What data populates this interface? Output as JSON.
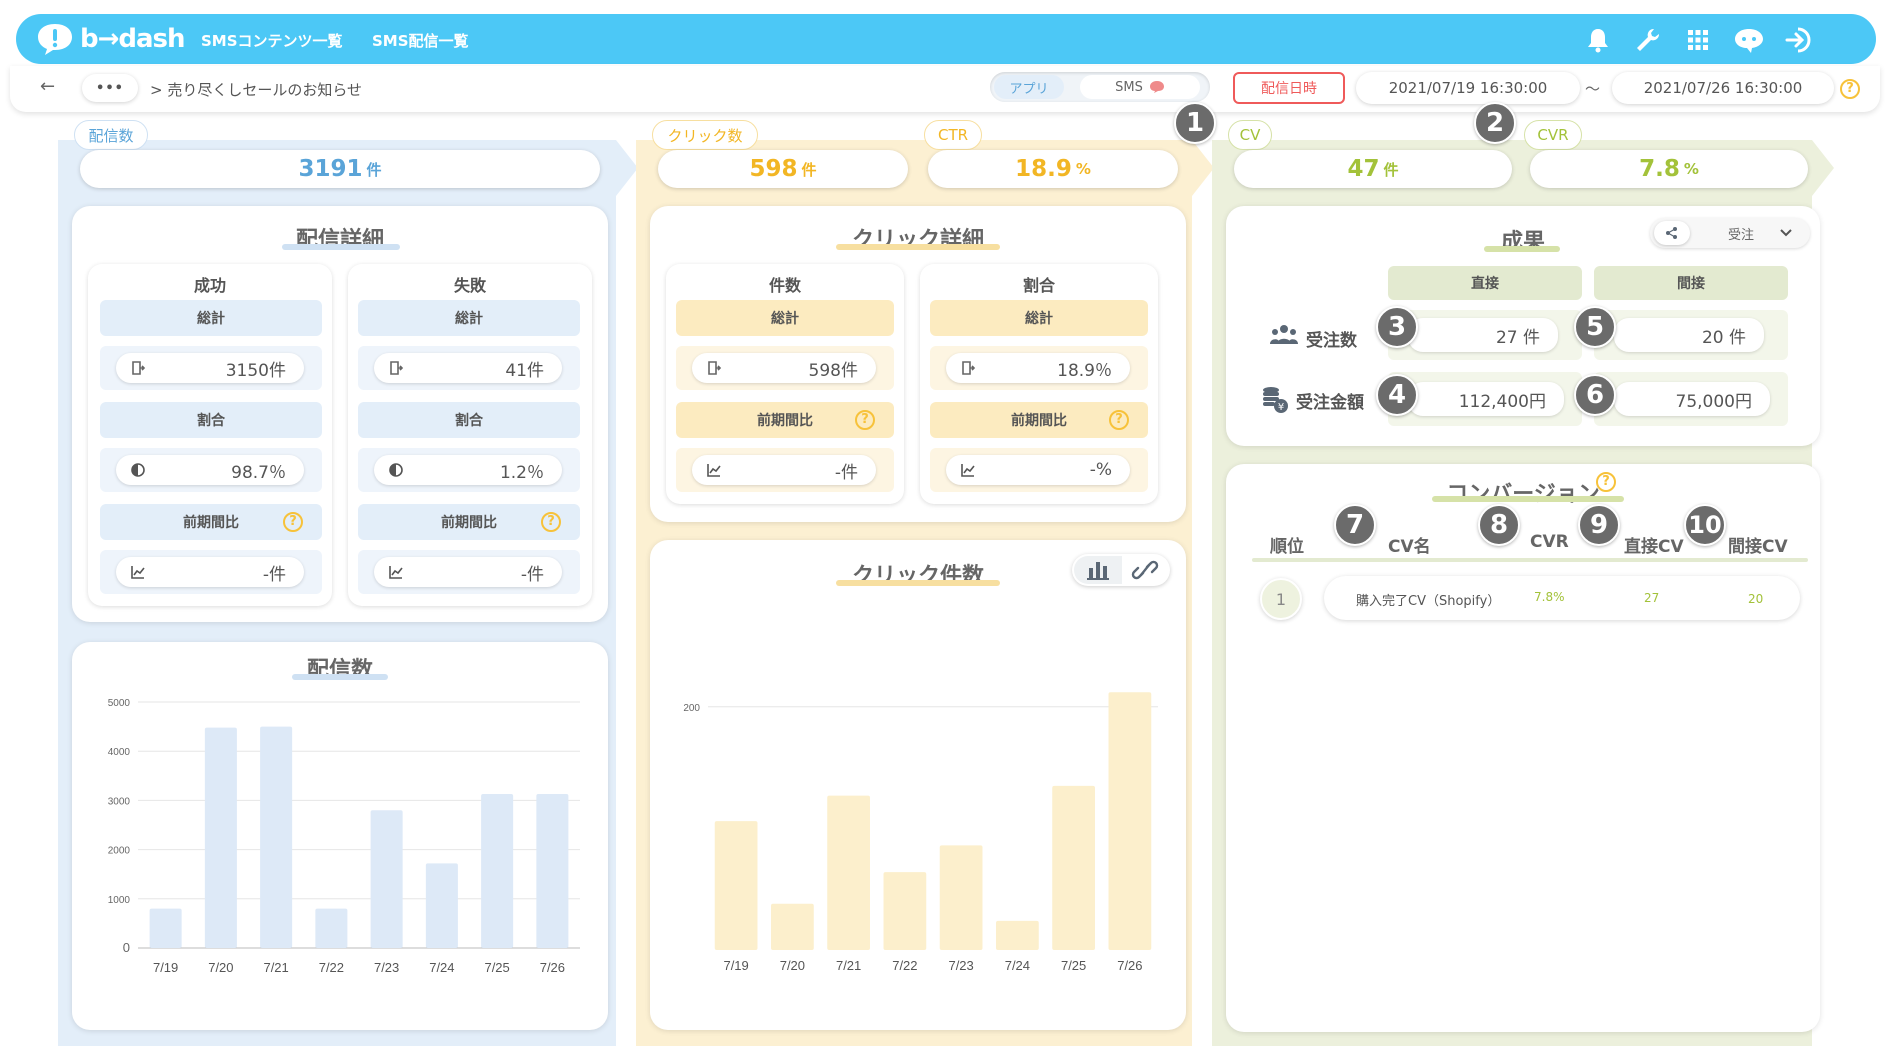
{
  "header": {
    "logo_text": "b→dash",
    "nav": [
      "SMSコンテンツ一覧",
      "SMS配信一覧"
    ],
    "icons": [
      "bell-icon",
      "wrench-icon",
      "grid-icon",
      "chat-icon",
      "logout-icon"
    ]
  },
  "subbar": {
    "back": "←",
    "more": "•••",
    "breadcrumb": "> 売り尽くしセールのお知らせ",
    "toggle_app": "アプリ",
    "toggle_sms": "SMS",
    "date_label": "配信日時",
    "date_from": "2021/07/19 16:30:00",
    "tilde": "〜",
    "date_to": "2021/07/26 16:30:00",
    "help": "?"
  },
  "colors": {
    "blue": "#5aa4d8",
    "blue_bg": "#e3eef9",
    "yellow": "#f2b624",
    "yellow_bg": "#fcf0d2",
    "green": "#a3c23a",
    "green_bg": "#ecf0dc",
    "red": "#ef5a5a"
  },
  "delivery": {
    "tab": "配信数",
    "value": "3191",
    "unit": "件",
    "detail_title": "配信詳細",
    "success": {
      "title": "成功",
      "total_label": "総計",
      "total": "3150件",
      "ratio_label": "割合",
      "ratio": "98.7％",
      "cmp_label": "前期間比",
      "cmp": "-件"
    },
    "fail": {
      "title": "失敗",
      "total_label": "総計",
      "total": "41件",
      "ratio_label": "割合",
      "ratio": "1.2％",
      "cmp_label": "前期間比",
      "cmp": "-件"
    },
    "chart_title": "配信数"
  },
  "click": {
    "tab_count": "クリック数",
    "count": "598",
    "unit": "件",
    "tab_ctr": "CTR",
    "ctr": "18.9",
    "ctr_unit": "%",
    "detail_title": "クリック詳細",
    "num": {
      "title": "件数",
      "total_label": "総計",
      "total": "598件",
      "cmp_label": "前期間比",
      "cmp": "-件"
    },
    "rate": {
      "title": "割合",
      "total_label": "総計",
      "total": "18.9％",
      "cmp_label": "前期間比",
      "cmp": "-%"
    },
    "chart_title": "クリック件数"
  },
  "cv": {
    "tab_cv": "CV",
    "cv": "47",
    "unit": "件",
    "tab_cvr": "CVR",
    "cvr": "7.8",
    "cvr_unit": "%",
    "result_title": "成果",
    "dropdown": "受注",
    "col_direct": "直接",
    "col_indirect": "間接",
    "row_orders": "受注数",
    "row_amount": "受注金額",
    "orders_direct": "27 件",
    "orders_indirect": "20 件",
    "amount_direct": "112,400円",
    "amount_indirect": "75,000円",
    "conv_title": "コンバージョン",
    "headers": [
      "順位",
      "CV名",
      "CVR",
      "直接CV",
      "間接CV"
    ],
    "rows": [
      {
        "rank": "1",
        "name": "購入完了CV（Shopify）",
        "cvr": "7.8%",
        "direct": "27",
        "indirect": "20"
      }
    ]
  },
  "badges": [
    "1",
    "2",
    "3",
    "4",
    "5",
    "6",
    "7",
    "8",
    "9",
    "10"
  ],
  "chart_data": [
    {
      "type": "bar",
      "categories": [
        "7/19",
        "7/20",
        "7/21",
        "7/22",
        "7/23",
        "7/24",
        "7/25",
        "7/26"
      ],
      "values": [
        800,
        4480,
        4500,
        800,
        2800,
        1720,
        3130,
        3130
      ],
      "title": "配信数",
      "ylim": [
        0,
        5000
      ],
      "yticks": [
        "0",
        "1000",
        "2000",
        "3000",
        "4000",
        "5000"
      ]
    },
    {
      "type": "bar",
      "categories": [
        "7/19",
        "7/20",
        "7/21",
        "7/22",
        "7/23",
        "7/24",
        "7/25",
        "7/26"
      ],
      "values": [
        106,
        38,
        127,
        64,
        86,
        24,
        135,
        212
      ],
      "title": "クリック件数",
      "ylim": [
        0,
        250
      ],
      "yticks": [
        "200"
      ]
    }
  ]
}
